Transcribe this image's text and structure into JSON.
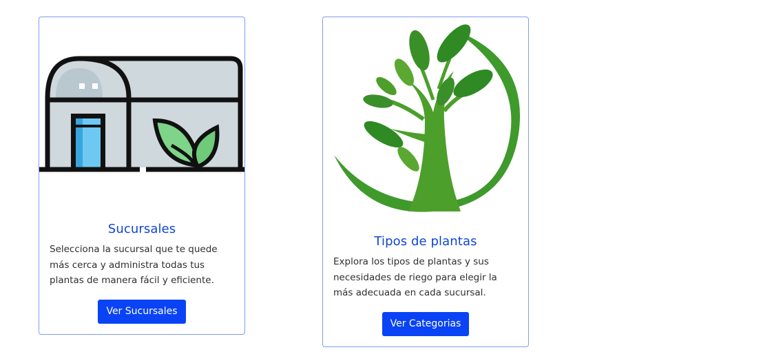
{
  "cards": [
    {
      "title": "Sucursales",
      "text": "Selecciona la sucursal que te quede más cerca y administra todas tus plantas de manera fácil y eficiente.",
      "button_label": "Ver Sucursales",
      "image_icon": "greenhouse-icon"
    },
    {
      "title": "Tipos de plantas",
      "text": "Explora los tipos de plantas y sus necesidades de riego para elegir la más adecuada en cada sucursal.",
      "button_label": "Ver Categorias",
      "image_icon": "tree-icon"
    }
  ],
  "colors": {
    "accent": "#0a43f5",
    "title": "#0d45d6",
    "card_border": "#7f9ef0",
    "leaf_green": "#3f9a2c"
  }
}
